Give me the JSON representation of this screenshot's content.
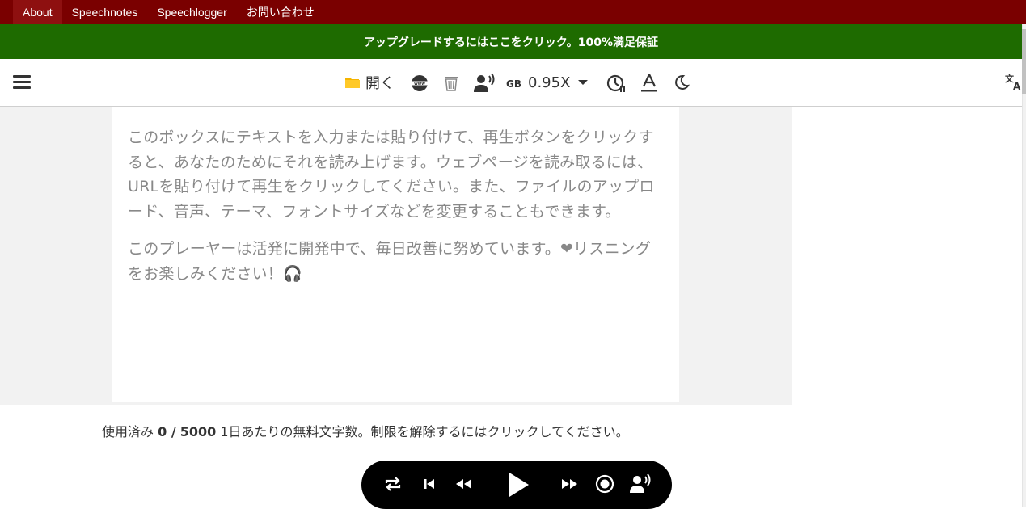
{
  "topnav": {
    "items": [
      "About",
      "Speechnotes",
      "Speechlogger",
      "お問い合わせ"
    ]
  },
  "promo": {
    "text": "アップグレードするにはここをクリック。100%満足保証"
  },
  "toolbar": {
    "open_label": "開く",
    "gb_label": "GB",
    "speed_label": "0.95X",
    "icons": [
      "menu-icon",
      "folder-icon",
      "web-icon",
      "trash-icon",
      "voice-icon",
      "chevron-down-icon",
      "timer-icon",
      "text-format-icon",
      "dark-mode-icon",
      "translate-icon"
    ]
  },
  "editor": {
    "paragraph1": "このボックスにテキストを入力または貼り付けて、再生ボタンをクリックすると、あなたのためにそれを読み上げます。ウェブページを読み取るには、URLを貼り付けて再生をクリックしてください。また、ファイルのアップロード、音声、テーマ、フォントサイズなどを変更することもできます。",
    "paragraph2": "このプレーヤーは活発に開発中で、毎日改善に努めています。❤リスニングをお楽しみください！🎧"
  },
  "usage": {
    "prefix": "使用済み",
    "used": "0 /",
    "limit": "5000",
    "suffix": "1日あたりの無料文字数。制限を解除するにはクリックしてください。"
  },
  "player": {
    "icons": [
      "repeat-icon",
      "skip-previous-icon",
      "rewind-icon",
      "play-icon",
      "fast-forward-icon",
      "record-icon",
      "voice-icon"
    ]
  },
  "colors": {
    "topnav": "#7a0000",
    "promo": "#1e6b00",
    "player": "#000000"
  }
}
